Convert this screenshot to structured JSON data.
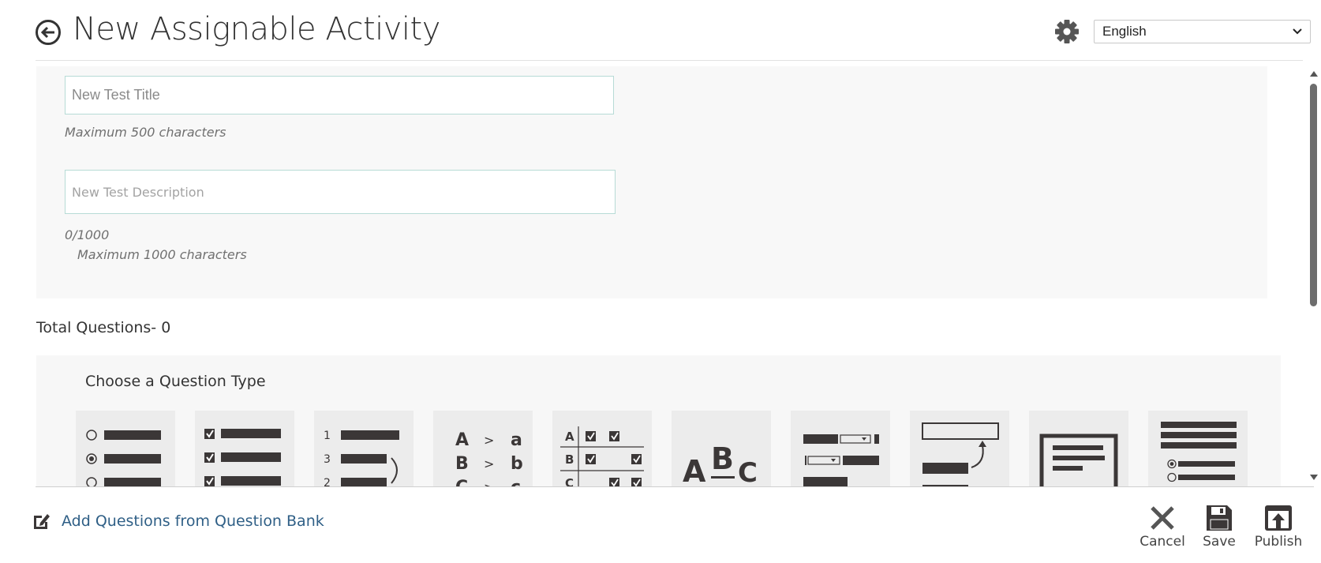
{
  "header": {
    "title": "New Assignable Activity",
    "language": {
      "selected": "English"
    }
  },
  "form": {
    "title_placeholder": "New Test Title",
    "title_hint": "Maximum 500 characters",
    "description_placeholder": "New Test Description",
    "description_count": "0/1000",
    "description_hint": "Maximum 1000 characters"
  },
  "questions": {
    "total_label": "Total Questions- 0",
    "chooser_heading": "Choose a Question Type",
    "types": [
      {
        "icon": "multiple-choice-icon"
      },
      {
        "icon": "multiple-response-icon"
      },
      {
        "icon": "ordering-icon"
      },
      {
        "icon": "matching-icon"
      },
      {
        "icon": "matrix-icon"
      },
      {
        "icon": "fill-in-blank-icon"
      },
      {
        "icon": "dropdown-icon"
      },
      {
        "icon": "drag-and-drop-icon"
      },
      {
        "icon": "essay-icon"
      },
      {
        "icon": "passage-icon"
      }
    ]
  },
  "footer": {
    "bank_label": "Add Questions from Question Bank",
    "cancel_label": "Cancel",
    "save_label": "Save",
    "publish_label": "Publish"
  },
  "icons": {
    "back": "circle-arrow-left-icon",
    "settings": "gear-icon",
    "bank": "edit-square-icon",
    "cancel": "close-icon",
    "save": "floppy-disk-icon",
    "publish": "upload-icon"
  },
  "colors": {
    "link": "#2f5f86",
    "input_border": "#b7dbd6",
    "icon_dark": "#3b3737"
  }
}
